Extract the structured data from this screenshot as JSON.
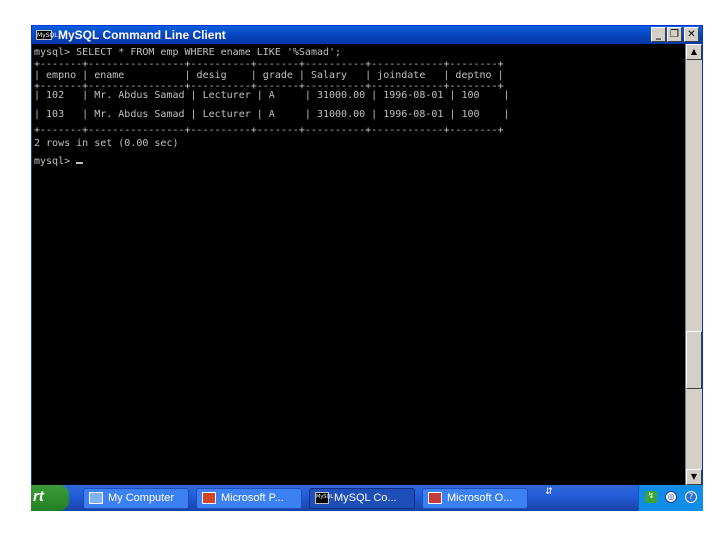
{
  "window": {
    "title": "MySQL Command Line Client",
    "app_icon_text": "MySQL",
    "minimize_glyph": "_",
    "maximize_glyph": "❐",
    "close_glyph": "✕"
  },
  "console": {
    "lines": [
      "mysql> SELECT * FROM emp WHERE ename LIKE '%Samad';",
      "+-------+----------------+----------+-------+----------+------------+--------+",
      "| empno | ename          | desig    | grade | Salary   | joindate   | deptno |",
      "+-------+----------------+----------+-------+----------+------------+--------+",
      "| 102   | Mr. Abdus Samad | Lecturer | A     | 31000.00 | 1996-08-01 | 100    |",
      "| 103   | Mr. Abdus Samad | Lecturer | A     | 31000.00 | 1996-08-01 | 100    |",
      "+-------+----------------+----------+-------+----------+------------+--------+",
      "2 rows in set (0.00 sec)",
      "",
      "mysql> "
    ],
    "prompt": "mysql> "
  },
  "scrollbar": {
    "up_glyph": "▲",
    "down_glyph": "▼"
  },
  "taskbar": {
    "start_label": "rt",
    "tasks": [
      {
        "label": "My Computer",
        "icon": "computer-icon"
      },
      {
        "label": "Microsoft P...",
        "icon": "powerpoint-icon"
      },
      {
        "label": "MySQL Co...",
        "icon": "mysql-icon",
        "active": true
      },
      {
        "label": "Microsoft O...",
        "icon": "office-icon"
      }
    ],
    "mysql_icon_text": "MySQL",
    "quick_glyph": "⇵",
    "tray": {
      "net_glyph": "↯",
      "sec_glyph": "◎",
      "help_glyph": "?"
    }
  }
}
